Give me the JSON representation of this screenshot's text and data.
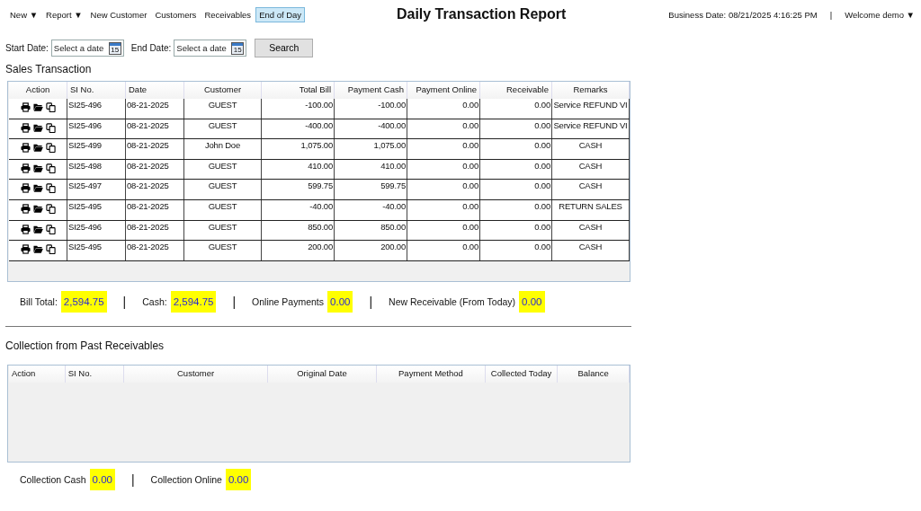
{
  "menu": [
    {
      "label": "New ▼",
      "selected": false
    },
    {
      "label": "Report ▼",
      "selected": false
    },
    {
      "label": "New Customer",
      "selected": false
    },
    {
      "label": "Customers",
      "selected": false
    },
    {
      "label": "Receivables",
      "selected": false
    },
    {
      "label": "End of Day",
      "selected": true
    }
  ],
  "title": "Daily Transaction Report",
  "business_date": "Business Date: 08/21/2025 4:16:25 PM",
  "separator": "|",
  "user_menu": "Welcome demo ▼",
  "filters": {
    "start_label": "Start Date:",
    "start_placeholder": "Select a date",
    "end_label": "End Date:",
    "end_placeholder": "Select a date",
    "start_calendar_day": "15",
    "end_calendar_day": "15",
    "search_button": "Search"
  },
  "sales": {
    "heading": "Sales Transaction",
    "columns": [
      "Action",
      "SI No.",
      "Date",
      "Customer",
      "Total Bill",
      "Payment Cash",
      "Payment Online",
      "Receivable",
      "Remarks"
    ],
    "rows": [
      {
        "si": "SI25-496",
        "date": "08-21-2025",
        "customer": "GUEST",
        "total": "-100.00",
        "cash": "-100.00",
        "online": "0.00",
        "receivable": "0.00",
        "remarks": "Service REFUND VI"
      },
      {
        "si": "SI25-496",
        "date": "08-21-2025",
        "customer": "GUEST",
        "total": "-400.00",
        "cash": "-400.00",
        "online": "0.00",
        "receivable": "0.00",
        "remarks": "Service REFUND VI"
      },
      {
        "si": "SI25-499",
        "date": "08-21-2025",
        "customer": "John Doe",
        "total": "1,075.00",
        "cash": "1,075.00",
        "online": "0.00",
        "receivable": "0.00",
        "remarks": "CASH"
      },
      {
        "si": "SI25-498",
        "date": "08-21-2025",
        "customer": "GUEST",
        "total": "410.00",
        "cash": "410.00",
        "online": "0.00",
        "receivable": "0.00",
        "remarks": "CASH"
      },
      {
        "si": "SI25-497",
        "date": "08-21-2025",
        "customer": "GUEST",
        "total": "599.75",
        "cash": "599.75",
        "online": "0.00",
        "receivable": "0.00",
        "remarks": "CASH"
      },
      {
        "si": "SI25-495",
        "date": "08-21-2025",
        "customer": "GUEST",
        "total": "-40.00",
        "cash": "-40.00",
        "online": "0.00",
        "receivable": "0.00",
        "remarks": "RETURN SALES"
      },
      {
        "si": "SI25-496",
        "date": "08-21-2025",
        "customer": "GUEST",
        "total": "850.00",
        "cash": "850.00",
        "online": "0.00",
        "receivable": "0.00",
        "remarks": "CASH"
      },
      {
        "si": "SI25-495",
        "date": "08-21-2025",
        "customer": "GUEST",
        "total": "200.00",
        "cash": "200.00",
        "online": "0.00",
        "receivable": "0.00",
        "remarks": "CASH"
      }
    ]
  },
  "totals": [
    {
      "label": "Bill Total:",
      "value": "2,594.75"
    },
    {
      "label": "Cash:",
      "value": "2,594.75"
    },
    {
      "label": "Online Payments",
      "value": "0.00"
    },
    {
      "label": "New Receivable (From Today)",
      "value": "0.00"
    }
  ],
  "totals_separators": [
    "|",
    "|",
    "|"
  ],
  "collection": {
    "heading": "Collection from  Past Receivables",
    "columns": [
      "Action",
      "SI No.",
      "Customer",
      "Original Date",
      "Payment Method",
      "Collected Today",
      "Balance"
    ]
  },
  "collection_totals": [
    {
      "label": "Collection Cash",
      "value": "0.00"
    },
    {
      "label": "Collection Online",
      "value": "0.00"
    }
  ],
  "collection_separators": [
    "|"
  ]
}
